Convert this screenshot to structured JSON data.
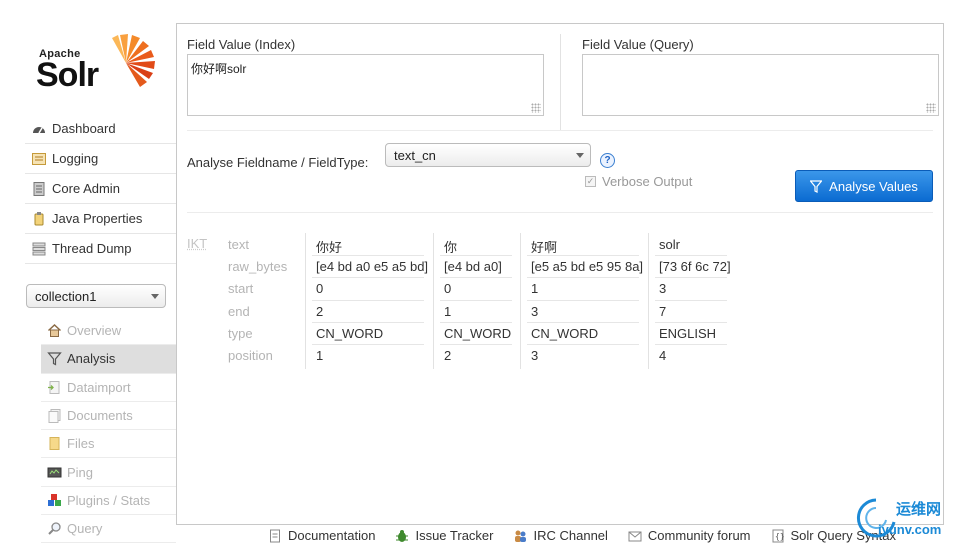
{
  "logo": {
    "apache": "Apache",
    "solr": "Solr"
  },
  "main_nav": [
    {
      "label": "Dashboard",
      "icon": "dashboard-icon"
    },
    {
      "label": "Logging",
      "icon": "logging-icon"
    },
    {
      "label": "Core Admin",
      "icon": "core-admin-icon"
    },
    {
      "label": "Java Properties",
      "icon": "java-properties-icon"
    },
    {
      "label": "Thread Dump",
      "icon": "thread-dump-icon"
    }
  ],
  "core_selector": {
    "value": "collection1"
  },
  "core_nav": [
    {
      "label": "Overview",
      "icon": "overview-icon"
    },
    {
      "label": "Analysis",
      "icon": "analysis-icon",
      "active": true
    },
    {
      "label": "Dataimport",
      "icon": "dataimport-icon"
    },
    {
      "label": "Documents",
      "icon": "documents-icon"
    },
    {
      "label": "Files",
      "icon": "files-icon"
    },
    {
      "label": "Ping",
      "icon": "ping-icon"
    },
    {
      "label": "Plugins / Stats",
      "icon": "plugins-icon"
    },
    {
      "label": "Query",
      "icon": "query-icon"
    }
  ],
  "analysis": {
    "index_label": "Field Value (Index)",
    "index_value": "你好啊solr",
    "query_label": "Field Value (Query)",
    "query_value": "",
    "fieldtype_label": "Analyse Fieldname / FieldType:",
    "fieldtype_value": "text_cn",
    "help_glyph": "?",
    "verbose_label": "Verbose Output",
    "verbose_checked": true,
    "button_label": "Analyse Values",
    "accent_color": "#0b6bd1"
  },
  "result": {
    "analyzer": "IKT",
    "rows": [
      "text",
      "raw_bytes",
      "start",
      "end",
      "type",
      "position"
    ],
    "tokens": [
      {
        "text": "你好",
        "raw_bytes": "[e4 bd a0 e5 a5 bd]",
        "start": "0",
        "end": "2",
        "type": "CN_WORD",
        "position": "1"
      },
      {
        "text": "你",
        "raw_bytes": "[e4 bd a0]",
        "start": "0",
        "end": "1",
        "type": "CN_WORD",
        "position": "2"
      },
      {
        "text": "好啊",
        "raw_bytes": "[e5 a5 bd e5 95 8a]",
        "start": "1",
        "end": "3",
        "type": "CN_WORD",
        "position": "3"
      },
      {
        "text": "solr",
        "raw_bytes": "[73 6f 6c 72]",
        "start": "3",
        "end": "7",
        "type": "ENGLISH",
        "position": "4"
      }
    ]
  },
  "footer": [
    {
      "label": "Documentation",
      "icon": "documentation-icon"
    },
    {
      "label": "Issue Tracker",
      "icon": "bug-icon"
    },
    {
      "label": "IRC Channel",
      "icon": "irc-icon"
    },
    {
      "label": "Community forum",
      "icon": "mail-icon"
    },
    {
      "label": "Solr Query Syntax",
      "icon": "query-syntax-icon"
    }
  ],
  "watermark": {
    "line1": "运维网",
    "line2": "iyunv.com"
  }
}
